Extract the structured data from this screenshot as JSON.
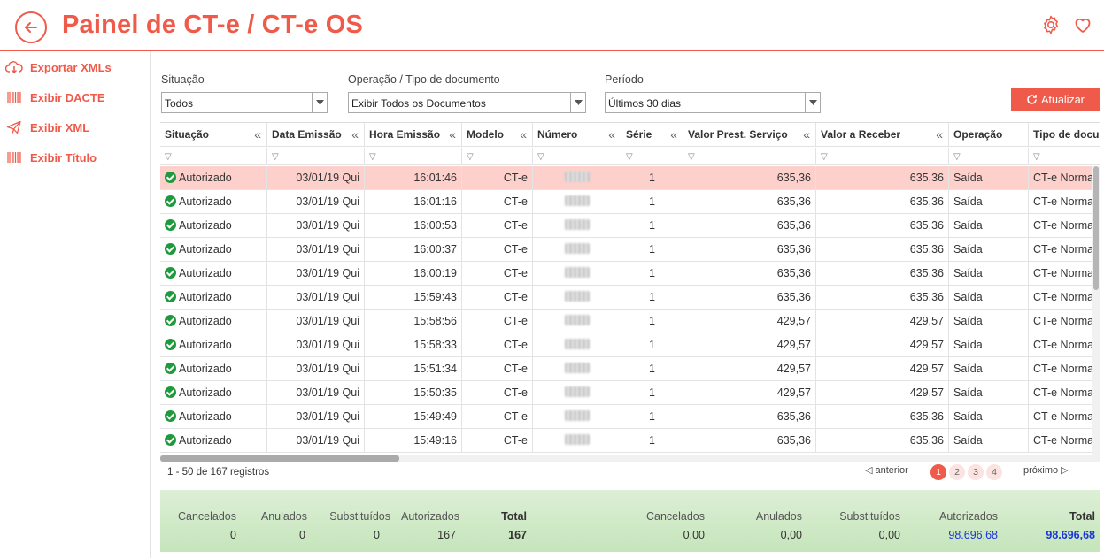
{
  "header": {
    "title": "Painel de CT-e / CT-e OS"
  },
  "sidebar": {
    "items": [
      {
        "label": "Exportar XMLs",
        "icon": "cloud-download-icon"
      },
      {
        "label": "Exibir DACTE",
        "icon": "barcode-icon"
      },
      {
        "label": "Exibir XML",
        "icon": "paper-plane-icon"
      },
      {
        "label": "Exibir Título",
        "icon": "barcode-icon"
      }
    ]
  },
  "filters": {
    "situacao": {
      "label": "Situação",
      "value": "Todos"
    },
    "operacao": {
      "label": "Operação / Tipo de documento",
      "value": "Exibir Todos os Documentos"
    },
    "periodo": {
      "label": "Período",
      "value": "Últimos 30 dias"
    },
    "refresh_label": "Atualizar"
  },
  "table": {
    "columns": [
      "Situação",
      "Data Emissão",
      "Hora Emissão",
      "Modelo",
      "Número",
      "Série",
      "Valor Prest. Serviço",
      "Valor a Receber",
      "Operação",
      "Tipo de documento"
    ],
    "rows": [
      [
        "Autorizado",
        "03/01/19 Qui",
        "16:01:46",
        "CT-e",
        "",
        "1",
        "635,36",
        "635,36",
        "Saída",
        "CT-e Normal"
      ],
      [
        "Autorizado",
        "03/01/19 Qui",
        "16:01:16",
        "CT-e",
        "",
        "1",
        "635,36",
        "635,36",
        "Saída",
        "CT-e Normal"
      ],
      [
        "Autorizado",
        "03/01/19 Qui",
        "16:00:53",
        "CT-e",
        "",
        "1",
        "635,36",
        "635,36",
        "Saída",
        "CT-e Normal"
      ],
      [
        "Autorizado",
        "03/01/19 Qui",
        "16:00:37",
        "CT-e",
        "",
        "1",
        "635,36",
        "635,36",
        "Saída",
        "CT-e Normal"
      ],
      [
        "Autorizado",
        "03/01/19 Qui",
        "16:00:19",
        "CT-e",
        "",
        "1",
        "635,36",
        "635,36",
        "Saída",
        "CT-e Normal"
      ],
      [
        "Autorizado",
        "03/01/19 Qui",
        "15:59:43",
        "CT-e",
        "",
        "1",
        "635,36",
        "635,36",
        "Saída",
        "CT-e Normal"
      ],
      [
        "Autorizado",
        "03/01/19 Qui",
        "15:58:56",
        "CT-e",
        "",
        "1",
        "429,57",
        "429,57",
        "Saída",
        "CT-e Normal"
      ],
      [
        "Autorizado",
        "03/01/19 Qui",
        "15:58:33",
        "CT-e",
        "",
        "1",
        "429,57",
        "429,57",
        "Saída",
        "CT-e Normal"
      ],
      [
        "Autorizado",
        "03/01/19 Qui",
        "15:51:34",
        "CT-e",
        "",
        "1",
        "429,57",
        "429,57",
        "Saída",
        "CT-e Normal"
      ],
      [
        "Autorizado",
        "03/01/19 Qui",
        "15:50:35",
        "CT-e",
        "",
        "1",
        "429,57",
        "429,57",
        "Saída",
        "CT-e Normal"
      ],
      [
        "Autorizado",
        "03/01/19 Qui",
        "15:49:49",
        "CT-e",
        "",
        "1",
        "635,36",
        "635,36",
        "Saída",
        "CT-e Normal"
      ],
      [
        "Autorizado",
        "03/01/19 Qui",
        "15:49:16",
        "CT-e",
        "",
        "1",
        "635,36",
        "635,36",
        "Saída",
        "CT-e Normal"
      ]
    ],
    "selected_row": 0
  },
  "pagination": {
    "record_count": "1 - 50 de 167 registros",
    "prev_label": "anterior",
    "next_label": "próximo",
    "pages": [
      "1",
      "2",
      "3",
      "4"
    ],
    "current_page": "1"
  },
  "totals": {
    "counts": [
      {
        "label": "Cancelados",
        "value": "0"
      },
      {
        "label": "Anulados",
        "value": "0"
      },
      {
        "label": "Substituídos",
        "value": "0"
      },
      {
        "label": "Autorizados",
        "value": "167"
      },
      {
        "label": "Total",
        "value": "167"
      }
    ],
    "values": [
      {
        "label": "Cancelados",
        "value": "0,00"
      },
      {
        "label": "Anulados",
        "value": "0,00"
      },
      {
        "label": "Substituídos",
        "value": "0,00"
      },
      {
        "label": "Autorizados",
        "value": "98.696,68"
      },
      {
        "label": "Total",
        "value": "98.696,68"
      }
    ]
  },
  "colors": {
    "accent": "#f05a4a",
    "status_ok": "#1e9a3d",
    "selected_row": "#fdd0cc",
    "total_blue": "#1a35d8"
  }
}
